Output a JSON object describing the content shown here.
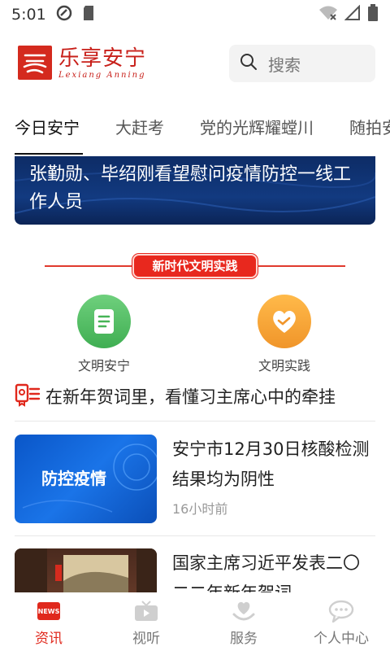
{
  "status_bar": {
    "time": "5:01"
  },
  "header": {
    "logo_cn": "乐享安宁",
    "logo_en": "Lexiang Anning",
    "search_placeholder": "搜索"
  },
  "tabs": [
    {
      "label": "今日安宁",
      "active": true
    },
    {
      "label": "大赶考"
    },
    {
      "label": "党的光辉耀螳川"
    },
    {
      "label": "随拍安宁"
    }
  ],
  "banner": {
    "title": "张勤勋、毕绍刚看望慰问疫情防控一线工作人员"
  },
  "section": {
    "label": "新时代文明实践"
  },
  "quick_links": [
    {
      "label": "文明安宁",
      "icon": "document-icon",
      "color": "#4cbc5c"
    },
    {
      "label": "文明实践",
      "icon": "handshake-icon",
      "color": "#f6a533"
    }
  ],
  "headline": {
    "text": "在新年贺词里，看懂习主席心中的牵挂"
  },
  "news": [
    {
      "thumb_text": "防控疫情",
      "title": "安宁市12月30日核酸检测结果均为阴性",
      "time": "16小时前"
    },
    {
      "thumb_text": "",
      "title": "国家主席习近平发表二〇二二年新年贺词",
      "time": ""
    }
  ],
  "bottom_nav": [
    {
      "label": "资讯",
      "icon": "news-icon",
      "active": true
    },
    {
      "label": "视听",
      "icon": "tv-icon"
    },
    {
      "label": "服务",
      "icon": "service-icon"
    },
    {
      "label": "个人中心",
      "icon": "chat-icon"
    }
  ],
  "colors": {
    "accent": "#e0281c",
    "banner": "#123a80",
    "green": "#4cbc5c",
    "orange": "#f6a533"
  }
}
